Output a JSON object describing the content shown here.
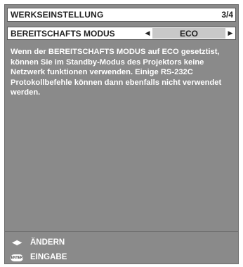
{
  "header": {
    "title": "WERKSEINSTELLUNG",
    "page": "3/4"
  },
  "setting": {
    "label": "BEREITSCHAFTS MODUS",
    "value": "ECO",
    "left_arrow_icon": "triangle-left",
    "right_arrow_icon": "triangle-right"
  },
  "description": {
    "text": "Wenn der BEREITSCHAFTS MODUS auf ECO gesetztist, können Sie im Standby-Modus des Projektors keine Netzwerk funktionen verwenden.  Einige RS-232C Protokollbefehle können dann ebenfalls nicht verwendet werden."
  },
  "footer": {
    "change_icon": "left-right-arrows",
    "change_glyph": "◀▶",
    "change_label": "ÄNDERN",
    "enter_icon": "enter-button",
    "enter_glyph": "ENTER",
    "enter_label": "EINGABE"
  },
  "colors": {
    "panel_background": "#8a8a8a",
    "header_background": "#ffffff",
    "value_background": "#c8c8c8",
    "text_light": "#ffffff",
    "text_dark": "#222222"
  }
}
